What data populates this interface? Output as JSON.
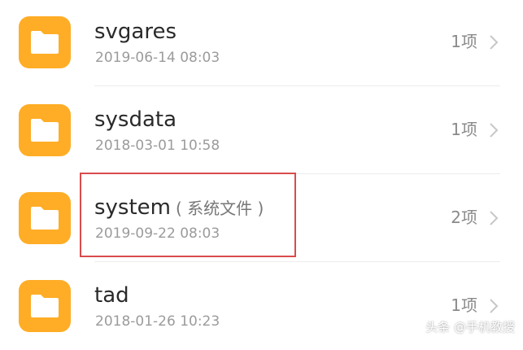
{
  "colors": {
    "folder": "#ffad26",
    "highlight": "#d94b4b",
    "divider": "#ececec"
  },
  "items": [
    {
      "name": "svgares",
      "tag": "",
      "date": "2019-06-14 08:03",
      "count": "1项",
      "icon": "folder-icon"
    },
    {
      "name": "sysdata",
      "tag": "",
      "date": "2018-03-01 10:58",
      "count": "1项",
      "icon": "folder-icon"
    },
    {
      "name": "system",
      "tag": "( 系统文件 )",
      "date": "2019-09-22 08:03",
      "count": "2项",
      "icon": "folder-icon"
    },
    {
      "name": "tad",
      "tag": "",
      "date": "2018-01-26 10:23",
      "count": "1项",
      "icon": "folder-icon"
    }
  ],
  "watermark": "头条 @手机教授"
}
